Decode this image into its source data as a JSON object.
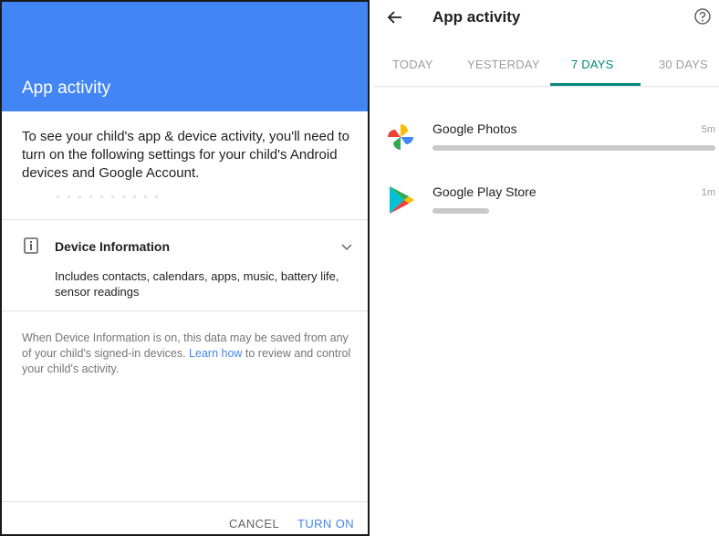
{
  "dialog": {
    "title": "App activity",
    "intro": "To see your child's app & device activity, you'll need to turn on the following settings for your child's Android devices and Google Account.",
    "setting": {
      "icon": "device-info-icon",
      "title": "Device Information",
      "description": "Includes contacts, calendars, apps, music, battery life, sensor readings"
    },
    "note_before": "When Device Information is on, this data may be saved from any of your child's signed-in devices. ",
    "note_link": "Learn how",
    "note_after": " to review and control your child's activity.",
    "cancel_label": "CANCEL",
    "turn_on_label": "TURN ON"
  },
  "activity": {
    "title": "App activity",
    "tabs": [
      "TODAY",
      "YESTERDAY",
      "7 DAYS",
      "30 DAYS"
    ],
    "selected_tab": "7 DAYS",
    "apps": [
      {
        "name": "Google Photos",
        "time": "5m",
        "usage_fraction": 1.0,
        "icon": "google-photos-icon"
      },
      {
        "name": "Google Play Store",
        "time": "1m",
        "usage_fraction": 0.2,
        "icon": "google-play-store-icon"
      }
    ]
  },
  "colors": {
    "header_blue": "#4285f4",
    "accent_teal": "#00897b",
    "link_blue": "#4285f4"
  }
}
